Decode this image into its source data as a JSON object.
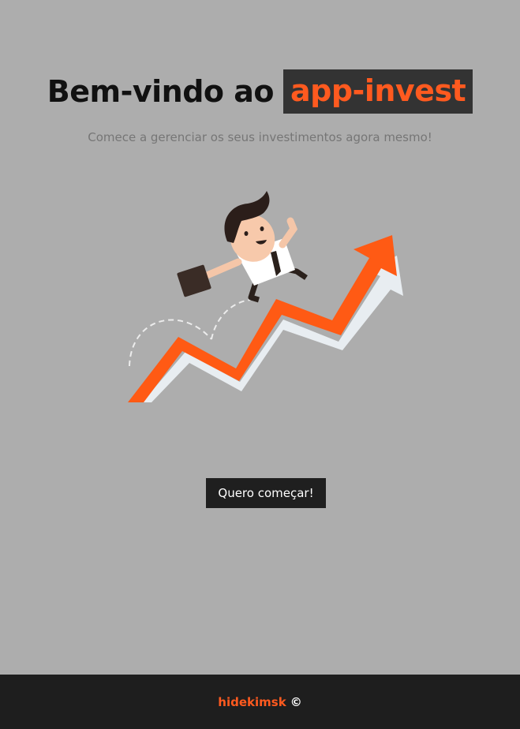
{
  "hero": {
    "title_prefix": "Bem-vindo ao",
    "brand": "app-invest",
    "subtitle": "Comece a gerenciar os seus investimentos agora mesmo!"
  },
  "illustration": {
    "icon": "businessman-growth-chart-illustration"
  },
  "cta": {
    "label": "Quero começar!"
  },
  "footer": {
    "author": "hidekimsk",
    "copyright": "©"
  },
  "colors": {
    "background": "#adadad",
    "accent": "#ff5a1f",
    "dark": "#1e1e1e",
    "brand_bg": "#333333"
  }
}
